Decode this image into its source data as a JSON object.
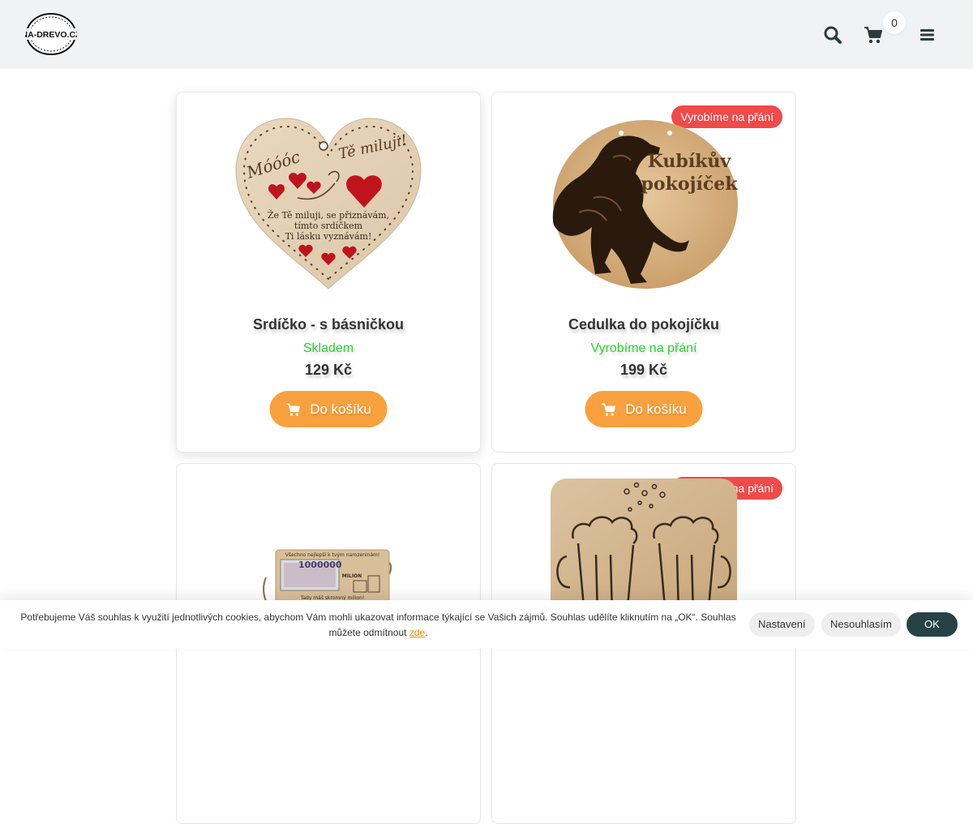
{
  "header": {
    "logo_text": "NA-DREVO.CZ",
    "cart_count": "0"
  },
  "products": [
    {
      "name": "Srdíčko - s básničkou",
      "availability": "Skladem",
      "price": "129 Kč",
      "button_label": "Do košíku",
      "badge": "",
      "image": {
        "left_text": "Móóóc",
        "right_text": "Tě miluji!",
        "line1": "Že Tě miluji, se přiznávám,",
        "line2": "tímto srdíčkem",
        "line3": "Ti lásku vyznávám!"
      }
    },
    {
      "name": "Cedulka do pokojíčku",
      "availability": "Vyrobíme na přání",
      "price": "199 Kč",
      "button_label": "Do košíku",
      "badge": "Vyrobíme na přání",
      "image": {
        "line1": "Kubíkův",
        "line2": "pokojíček"
      }
    },
    {
      "name": "",
      "availability": "",
      "price": "",
      "button_label": "",
      "badge": "",
      "image": {
        "line1": "Všechno nejlepší k tvým narozeninám!",
        "amount": "1000000",
        "label": "MILION",
        "line2": "Tady máš skromný milion!"
      }
    },
    {
      "name": "",
      "availability": "",
      "price": "",
      "button_label": "",
      "badge": "Vyrobíme na přání"
    }
  ],
  "cookie": {
    "text": "Potřebujeme Váš souhlas k využití jednotlivých cookies, abychom Vám mohli ukazovat informace týkající se Vašich zájmů. Souhlas udělíte kliknutím na „OK“. Souhlas můžete odmítnout",
    "link_text": "zde",
    "settings_label": "Nastavení",
    "decline_label": "Nesouhlasím",
    "ok_label": "OK"
  },
  "colors": {
    "header_bg": "#f0f2f3",
    "accent_orange": "#f8a13e",
    "badge_red": "#f04a4a",
    "in_stock_green": "#2ed12e",
    "ok_button": "#274246"
  },
  "icons": [
    "logo",
    "search-icon",
    "cart-icon",
    "hamburger-menu-icon",
    "cart-add-icon"
  ]
}
